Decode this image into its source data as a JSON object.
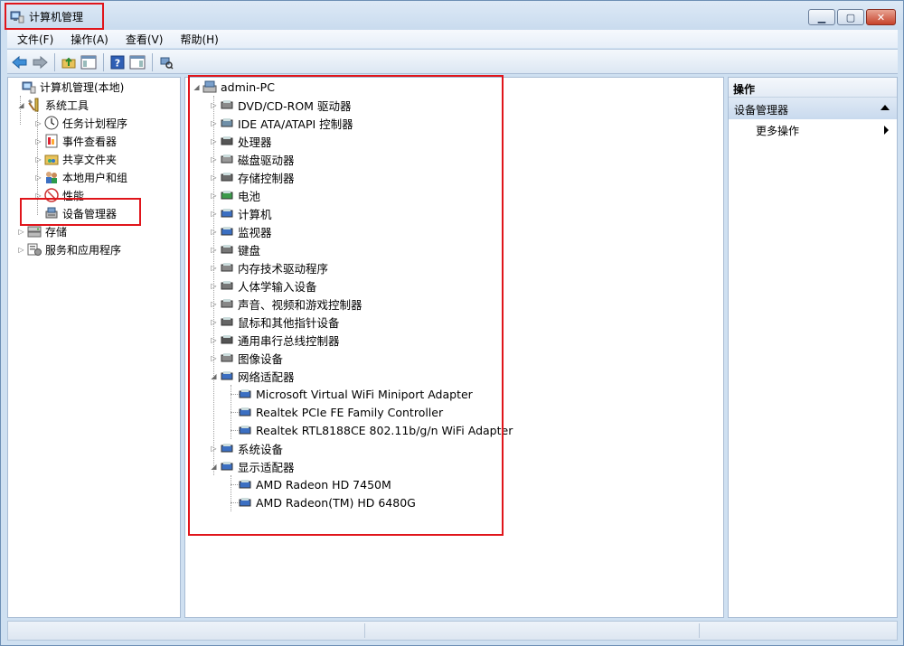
{
  "window": {
    "title": "计算机管理"
  },
  "menu": {
    "items": [
      "文件(F)",
      "操作(A)",
      "查看(V)",
      "帮助(H)"
    ]
  },
  "left_tree": {
    "root": "计算机管理(本地)",
    "system_tools": "系统工具",
    "system_children": [
      "任务计划程序",
      "事件查看器",
      "共享文件夹",
      "本地用户和组",
      "性能",
      "设备管理器"
    ],
    "storage": "存储",
    "services": "服务和应用程序"
  },
  "device_tree": {
    "root": "admin-PC",
    "categories": [
      "DVD/CD-ROM 驱动器",
      "IDE ATA/ATAPI 控制器",
      "处理器",
      "磁盘驱动器",
      "存储控制器",
      "电池",
      "计算机",
      "监视器",
      "键盘",
      "内存技术驱动程序",
      "人体学输入设备",
      "声音、视频和游戏控制器",
      "鼠标和其他指针设备",
      "通用串行总线控制器",
      "图像设备",
      "网络适配器",
      "系统设备",
      "显示适配器"
    ],
    "network_children": [
      "Microsoft Virtual WiFi Miniport Adapter",
      "Realtek PCIe FE Family Controller",
      "Realtek RTL8188CE 802.11b/g/n WiFi Adapter"
    ],
    "display_children": [
      "AMD Radeon HD 7450M",
      "AMD Radeon(TM) HD 6480G"
    ]
  },
  "actions": {
    "header": "操作",
    "section": "设备管理器",
    "more": "更多操作"
  },
  "colors": {
    "highlight": "#e0151b",
    "chrome": "#cfe0f1"
  }
}
